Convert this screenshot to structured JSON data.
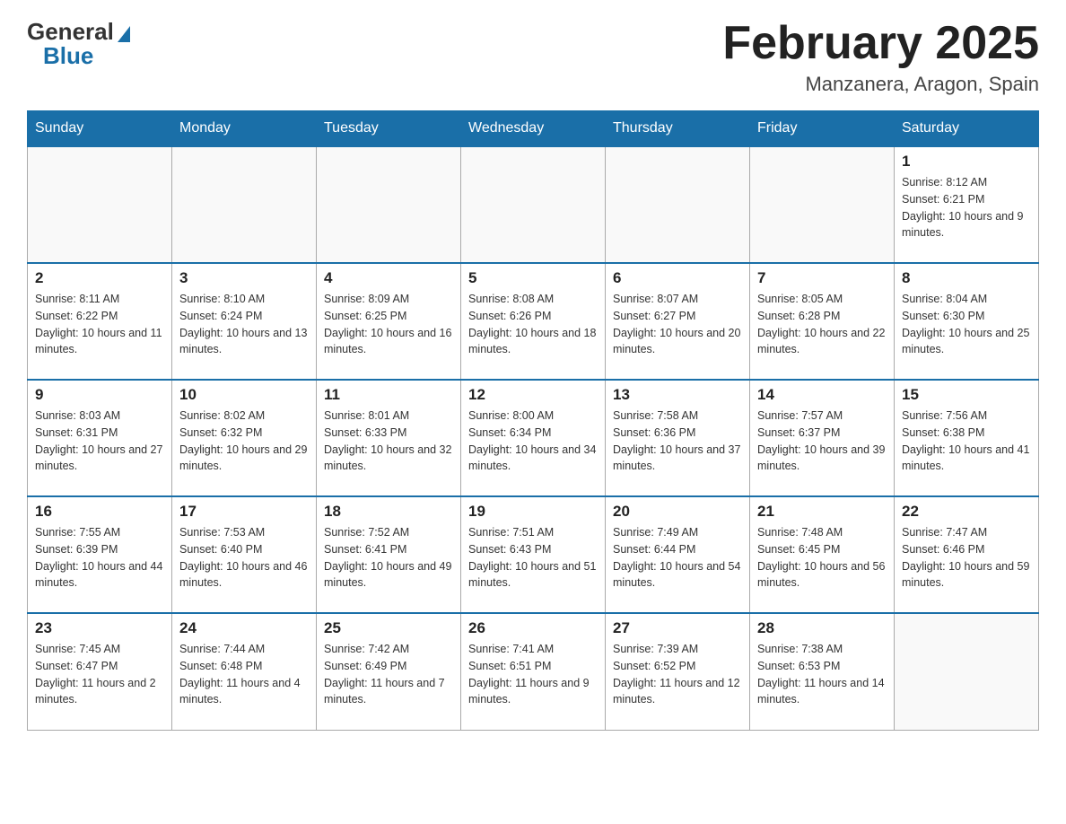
{
  "logo": {
    "general": "General",
    "blue": "Blue"
  },
  "header": {
    "title": "February 2025",
    "location": "Manzanera, Aragon, Spain"
  },
  "weekdays": [
    "Sunday",
    "Monday",
    "Tuesday",
    "Wednesday",
    "Thursday",
    "Friday",
    "Saturday"
  ],
  "weeks": [
    [
      {
        "day": "",
        "info": ""
      },
      {
        "day": "",
        "info": ""
      },
      {
        "day": "",
        "info": ""
      },
      {
        "day": "",
        "info": ""
      },
      {
        "day": "",
        "info": ""
      },
      {
        "day": "",
        "info": ""
      },
      {
        "day": "1",
        "info": "Sunrise: 8:12 AM\nSunset: 6:21 PM\nDaylight: 10 hours and 9 minutes."
      }
    ],
    [
      {
        "day": "2",
        "info": "Sunrise: 8:11 AM\nSunset: 6:22 PM\nDaylight: 10 hours and 11 minutes."
      },
      {
        "day": "3",
        "info": "Sunrise: 8:10 AM\nSunset: 6:24 PM\nDaylight: 10 hours and 13 minutes."
      },
      {
        "day": "4",
        "info": "Sunrise: 8:09 AM\nSunset: 6:25 PM\nDaylight: 10 hours and 16 minutes."
      },
      {
        "day": "5",
        "info": "Sunrise: 8:08 AM\nSunset: 6:26 PM\nDaylight: 10 hours and 18 minutes."
      },
      {
        "day": "6",
        "info": "Sunrise: 8:07 AM\nSunset: 6:27 PM\nDaylight: 10 hours and 20 minutes."
      },
      {
        "day": "7",
        "info": "Sunrise: 8:05 AM\nSunset: 6:28 PM\nDaylight: 10 hours and 22 minutes."
      },
      {
        "day": "8",
        "info": "Sunrise: 8:04 AM\nSunset: 6:30 PM\nDaylight: 10 hours and 25 minutes."
      }
    ],
    [
      {
        "day": "9",
        "info": "Sunrise: 8:03 AM\nSunset: 6:31 PM\nDaylight: 10 hours and 27 minutes."
      },
      {
        "day": "10",
        "info": "Sunrise: 8:02 AM\nSunset: 6:32 PM\nDaylight: 10 hours and 29 minutes."
      },
      {
        "day": "11",
        "info": "Sunrise: 8:01 AM\nSunset: 6:33 PM\nDaylight: 10 hours and 32 minutes."
      },
      {
        "day": "12",
        "info": "Sunrise: 8:00 AM\nSunset: 6:34 PM\nDaylight: 10 hours and 34 minutes."
      },
      {
        "day": "13",
        "info": "Sunrise: 7:58 AM\nSunset: 6:36 PM\nDaylight: 10 hours and 37 minutes."
      },
      {
        "day": "14",
        "info": "Sunrise: 7:57 AM\nSunset: 6:37 PM\nDaylight: 10 hours and 39 minutes."
      },
      {
        "day": "15",
        "info": "Sunrise: 7:56 AM\nSunset: 6:38 PM\nDaylight: 10 hours and 41 minutes."
      }
    ],
    [
      {
        "day": "16",
        "info": "Sunrise: 7:55 AM\nSunset: 6:39 PM\nDaylight: 10 hours and 44 minutes."
      },
      {
        "day": "17",
        "info": "Sunrise: 7:53 AM\nSunset: 6:40 PM\nDaylight: 10 hours and 46 minutes."
      },
      {
        "day": "18",
        "info": "Sunrise: 7:52 AM\nSunset: 6:41 PM\nDaylight: 10 hours and 49 minutes."
      },
      {
        "day": "19",
        "info": "Sunrise: 7:51 AM\nSunset: 6:43 PM\nDaylight: 10 hours and 51 minutes."
      },
      {
        "day": "20",
        "info": "Sunrise: 7:49 AM\nSunset: 6:44 PM\nDaylight: 10 hours and 54 minutes."
      },
      {
        "day": "21",
        "info": "Sunrise: 7:48 AM\nSunset: 6:45 PM\nDaylight: 10 hours and 56 minutes."
      },
      {
        "day": "22",
        "info": "Sunrise: 7:47 AM\nSunset: 6:46 PM\nDaylight: 10 hours and 59 minutes."
      }
    ],
    [
      {
        "day": "23",
        "info": "Sunrise: 7:45 AM\nSunset: 6:47 PM\nDaylight: 11 hours and 2 minutes."
      },
      {
        "day": "24",
        "info": "Sunrise: 7:44 AM\nSunset: 6:48 PM\nDaylight: 11 hours and 4 minutes."
      },
      {
        "day": "25",
        "info": "Sunrise: 7:42 AM\nSunset: 6:49 PM\nDaylight: 11 hours and 7 minutes."
      },
      {
        "day": "26",
        "info": "Sunrise: 7:41 AM\nSunset: 6:51 PM\nDaylight: 11 hours and 9 minutes."
      },
      {
        "day": "27",
        "info": "Sunrise: 7:39 AM\nSunset: 6:52 PM\nDaylight: 11 hours and 12 minutes."
      },
      {
        "day": "28",
        "info": "Sunrise: 7:38 AM\nSunset: 6:53 PM\nDaylight: 11 hours and 14 minutes."
      },
      {
        "day": "",
        "info": ""
      }
    ]
  ]
}
